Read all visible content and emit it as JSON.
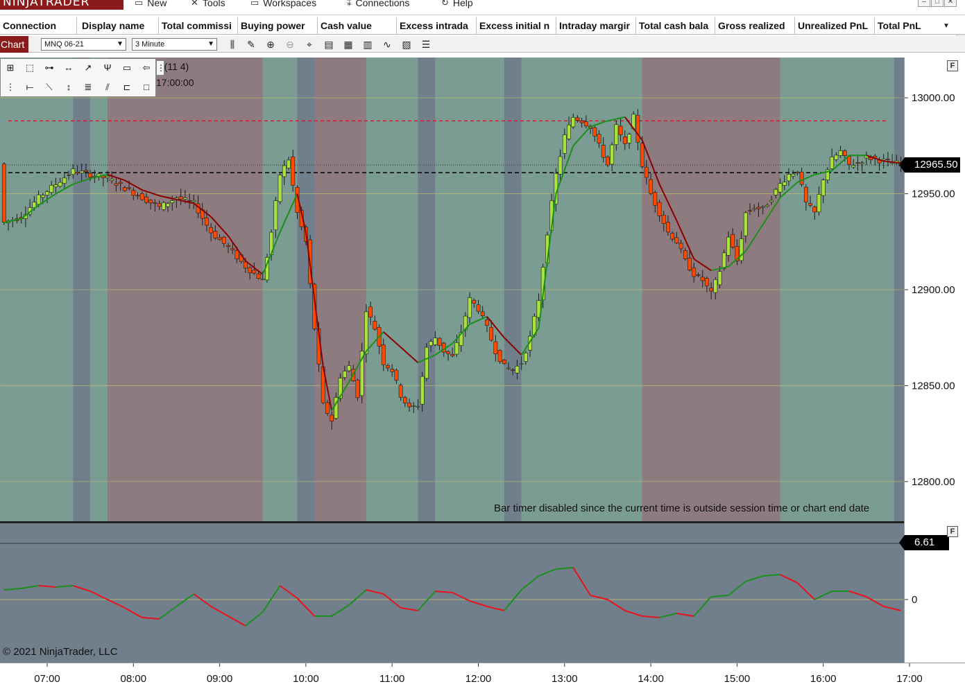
{
  "app": {
    "logo": "NINJATRADER"
  },
  "menu": [
    {
      "label": "New",
      "icon": "new-window-icon"
    },
    {
      "label": "Tools",
      "icon": "tools-icon"
    },
    {
      "label": "Workspaces",
      "icon": "workspaces-icon"
    },
    {
      "label": "Connections",
      "icon": "connections-icon"
    },
    {
      "label": "Help",
      "icon": "help-icon"
    }
  ],
  "accounts_grid": {
    "columns": [
      "Connection",
      "Display name",
      "Total commissi",
      "Buying power",
      "Cash value",
      "Excess intrada",
      "Excess initial n",
      "Intraday margir",
      "Total cash bala",
      "Gross realized",
      "Unrealized PnL",
      "Total PnL"
    ]
  },
  "chart_toolbar": {
    "tab_label": "Chart",
    "instrument": "MNQ 06-21",
    "interval": "3 Minute"
  },
  "indicator_label": {
    "line1": "rs(11 4)",
    "line2": "17:00:00"
  },
  "messages": {
    "bar_timer": "Bar timer disabled since the current time is outside session time or chart end date",
    "copyright": "© 2021 NinjaTrader, LLC"
  },
  "colors": {
    "bull": "#a9e33a",
    "bear": "#ff4a00",
    "ma_up": "#1a8f1a",
    "ma_down": "#8b0000",
    "band_green": "#7b9c93",
    "band_red": "#8e7b7f",
    "band_blue": "#717f8c"
  },
  "chart_data": [
    {
      "type": "candlestick",
      "instrument": "MNQ 06-21",
      "interval": "3 Minute",
      "x_ticks": [
        "07:00",
        "08:00",
        "09:00",
        "10:00",
        "11:00",
        "12:00",
        "13:00",
        "14:00",
        "15:00",
        "16:00",
        "17:00"
      ],
      "y_ticks": [
        "13000.00",
        "12950.00",
        "12900.00",
        "12850.00",
        "12800.00"
      ],
      "ylim": [
        12779,
        13021
      ],
      "last_price": "12965.50",
      "last_price_value": 12965.5,
      "reference_line_red": 12988,
      "reference_line_black": 12961,
      "reference_line_dotted": 12965,
      "session_bands": [
        {
          "from": "06:30",
          "to": "07:18",
          "color": "green"
        },
        {
          "from": "07:18",
          "to": "07:30",
          "color": "blue"
        },
        {
          "from": "07:30",
          "to": "07:42",
          "color": "green"
        },
        {
          "from": "07:42",
          "to": "09:30",
          "color": "red"
        },
        {
          "from": "09:30",
          "to": "09:54",
          "color": "green"
        },
        {
          "from": "09:54",
          "to": "10:06",
          "color": "blue"
        },
        {
          "from": "10:06",
          "to": "10:42",
          "color": "red"
        },
        {
          "from": "10:42",
          "to": "11:18",
          "color": "green"
        },
        {
          "from": "11:18",
          "to": "11:30",
          "color": "blue"
        },
        {
          "from": "11:30",
          "to": "12:18",
          "color": "green"
        },
        {
          "from": "12:18",
          "to": "12:30",
          "color": "blue"
        },
        {
          "from": "12:30",
          "to": "13:54",
          "color": "green"
        },
        {
          "from": "13:54",
          "to": "15:30",
          "color": "red"
        },
        {
          "from": "15:30",
          "to": "17:00",
          "color": "green"
        }
      ],
      "close_path": [
        [
          "06:30",
          12935
        ],
        [
          "06:42",
          12938
        ],
        [
          "06:54",
          12948
        ],
        [
          "07:06",
          12955
        ],
        [
          "07:18",
          12962
        ],
        [
          "07:30",
          12960
        ],
        [
          "07:42",
          12958
        ],
        [
          "07:54",
          12953
        ],
        [
          "08:06",
          12948
        ],
        [
          "08:18",
          12943
        ],
        [
          "08:30",
          12948
        ],
        [
          "08:42",
          12945
        ],
        [
          "08:54",
          12930
        ],
        [
          "09:06",
          12922
        ],
        [
          "09:18",
          12912
        ],
        [
          "09:30",
          12905
        ],
        [
          "09:36",
          12930
        ],
        [
          "09:42",
          12960
        ],
        [
          "09:48",
          12968
        ],
        [
          "09:54",
          12940
        ],
        [
          "10:00",
          12925
        ],
        [
          "10:06",
          12880
        ],
        [
          "10:12",
          12840
        ],
        [
          "10:18",
          12832
        ],
        [
          "10:24",
          12855
        ],
        [
          "10:30",
          12860
        ],
        [
          "10:36",
          12845
        ],
        [
          "10:42",
          12890
        ],
        [
          "10:48",
          12880
        ],
        [
          "10:54",
          12862
        ],
        [
          "11:00",
          12858
        ],
        [
          "11:06",
          12845
        ],
        [
          "11:12",
          12838
        ],
        [
          "11:18",
          12840
        ],
        [
          "11:24",
          12870
        ],
        [
          "11:30",
          12875
        ],
        [
          "11:36",
          12868
        ],
        [
          "11:42",
          12865
        ],
        [
          "11:48",
          12878
        ],
        [
          "11:54",
          12895
        ],
        [
          "12:00",
          12890
        ],
        [
          "12:06",
          12880
        ],
        [
          "12:12",
          12868
        ],
        [
          "12:18",
          12860
        ],
        [
          "12:24",
          12858
        ],
        [
          "12:30",
          12862
        ],
        [
          "12:36",
          12875
        ],
        [
          "12:42",
          12895
        ],
        [
          "12:48",
          12930
        ],
        [
          "12:54",
          12960
        ],
        [
          "13:00",
          12980
        ],
        [
          "13:06",
          12990
        ],
        [
          "13:12",
          12988
        ],
        [
          "13:18",
          12985
        ],
        [
          "13:24",
          12975
        ],
        [
          "13:30",
          12965
        ],
        [
          "13:36",
          12985
        ],
        [
          "13:42",
          12975
        ],
        [
          "13:48",
          12990
        ],
        [
          "13:54",
          12965
        ],
        [
          "14:00",
          12950
        ],
        [
          "14:06",
          12940
        ],
        [
          "14:12",
          12930
        ],
        [
          "14:18",
          12925
        ],
        [
          "14:24",
          12915
        ],
        [
          "14:30",
          12908
        ],
        [
          "14:36",
          12905
        ],
        [
          "14:42",
          12898
        ],
        [
          "14:48",
          12910
        ],
        [
          "14:54",
          12928
        ],
        [
          "15:00",
          12915
        ],
        [
          "15:06",
          12940
        ],
        [
          "15:12",
          12943
        ],
        [
          "15:18",
          12942
        ],
        [
          "15:24",
          12948
        ],
        [
          "15:30",
          12955
        ],
        [
          "15:36",
          12960
        ],
        [
          "15:42",
          12962
        ],
        [
          "15:48",
          12945
        ],
        [
          "15:54",
          12940
        ],
        [
          "16:00",
          12958
        ],
        [
          "16:06",
          12968
        ],
        [
          "16:12",
          12972
        ],
        [
          "16:18",
          12965
        ],
        [
          "16:24",
          12966
        ],
        [
          "16:30",
          12969
        ],
        [
          "16:42",
          12967
        ],
        [
          "16:54",
          12965.5
        ]
      ],
      "ma_path": [
        [
          "06:30",
          12935
        ],
        [
          "06:42",
          12937
        ],
        [
          "06:54",
          12944
        ],
        [
          "07:06",
          12950
        ],
        [
          "07:18",
          12955
        ],
        [
          "07:30",
          12958
        ],
        [
          "07:42",
          12960
        ],
        [
          "07:54",
          12957
        ],
        [
          "08:06",
          12952
        ],
        [
          "08:18",
          12949
        ],
        [
          "08:30",
          12947
        ],
        [
          "08:42",
          12945
        ],
        [
          "08:54",
          12938
        ],
        [
          "09:06",
          12928
        ],
        [
          "09:18",
          12915
        ],
        [
          "09:30",
          12908
        ],
        [
          "09:42",
          12930
        ],
        [
          "09:54",
          12950
        ],
        [
          "10:00",
          12930
        ],
        [
          "10:06",
          12895
        ],
        [
          "10:12",
          12860
        ],
        [
          "10:18",
          12837
        ],
        [
          "10:30",
          12852
        ],
        [
          "10:42",
          12868
        ],
        [
          "10:54",
          12878
        ],
        [
          "11:06",
          12870
        ],
        [
          "11:18",
          12862
        ],
        [
          "11:30",
          12866
        ],
        [
          "11:42",
          12872
        ],
        [
          "11:54",
          12882
        ],
        [
          "12:06",
          12886
        ],
        [
          "12:18",
          12875
        ],
        [
          "12:30",
          12866
        ],
        [
          "12:42",
          12880
        ],
        [
          "12:48",
          12915
        ],
        [
          "12:54",
          12950
        ],
        [
          "13:06",
          12975
        ],
        [
          "13:18",
          12985
        ],
        [
          "13:30",
          12988
        ],
        [
          "13:42",
          12990
        ],
        [
          "13:54",
          12978
        ],
        [
          "14:06",
          12955
        ],
        [
          "14:18",
          12936
        ],
        [
          "14:30",
          12916
        ],
        [
          "14:42",
          12910
        ],
        [
          "14:54",
          12912
        ],
        [
          "15:06",
          12920
        ],
        [
          "15:18",
          12934
        ],
        [
          "15:30",
          12948
        ],
        [
          "15:42",
          12956
        ],
        [
          "15:54",
          12960
        ],
        [
          "16:06",
          12962
        ],
        [
          "16:18",
          12970
        ],
        [
          "16:30",
          12970
        ],
        [
          "16:42",
          12967
        ],
        [
          "16:54",
          12966
        ]
      ]
    },
    {
      "type": "line",
      "name": "oscillator",
      "y_ticks": [
        "0"
      ],
      "last_value": "6.61",
      "ylim": [
        -40,
        40
      ],
      "x": [
        "06:30",
        "06:42",
        "06:54",
        "07:06",
        "07:18",
        "07:30",
        "07:42",
        "07:54",
        "08:06",
        "08:18",
        "08:30",
        "08:42",
        "08:54",
        "09:06",
        "09:18",
        "09:30",
        "09:42",
        "09:54",
        "10:06",
        "10:18",
        "10:30",
        "10:42",
        "10:54",
        "11:06",
        "11:18",
        "11:30",
        "11:42",
        "11:54",
        "12:06",
        "12:18",
        "12:30",
        "12:42",
        "12:54",
        "13:06",
        "13:18",
        "13:30",
        "13:42",
        "13:54",
        "14:06",
        "14:18",
        "14:30",
        "14:42",
        "14:54",
        "15:06",
        "15:18",
        "15:30",
        "15:42",
        "15:54",
        "16:06",
        "16:18",
        "16:30",
        "16:42",
        "16:54"
      ],
      "values": [
        7,
        8,
        10,
        9,
        10,
        6,
        0,
        -6,
        -13,
        -14,
        -5,
        4,
        -5,
        -12,
        -19,
        -9,
        10,
        1,
        -12,
        -12,
        -4,
        7,
        4,
        -6,
        -8,
        6,
        5,
        -1,
        -5,
        -8,
        7,
        17,
        22,
        23,
        3,
        0,
        -8,
        -12,
        -13,
        -10,
        -12,
        2,
        3,
        13,
        17,
        18,
        12,
        0,
        6,
        6,
        2,
        -5,
        -8
      ]
    }
  ]
}
